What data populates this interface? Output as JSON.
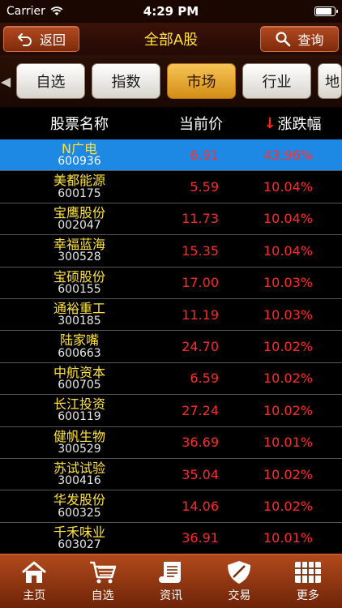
{
  "status_bar": {
    "carrier": "Carrier",
    "time": "4:29 PM",
    "battery_level": 0.9
  },
  "nav": {
    "back_label": "返回",
    "title": "全部A股",
    "search_label": "查询"
  },
  "tabs": [
    {
      "label": "自选",
      "active": false
    },
    {
      "label": "指数",
      "active": false
    },
    {
      "label": "市场",
      "active": true
    },
    {
      "label": "行业",
      "active": false
    },
    {
      "label": "地",
      "active": false
    }
  ],
  "table_header": {
    "name": "股票名称",
    "price": "当前价",
    "change": "涨跌幅"
  },
  "stocks": [
    {
      "name": "N广电",
      "code": "600936",
      "price": "6.91",
      "change": "43.96%"
    },
    {
      "name": "美都能源",
      "code": "600175",
      "price": "5.59",
      "change": "10.04%"
    },
    {
      "name": "宝鹰股份",
      "code": "002047",
      "price": "11.73",
      "change": "10.04%"
    },
    {
      "name": "幸福蓝海",
      "code": "300528",
      "price": "15.35",
      "change": "10.04%"
    },
    {
      "name": "宝硕股份",
      "code": "600155",
      "price": "17.00",
      "change": "10.03%"
    },
    {
      "name": "通裕重工",
      "code": "300185",
      "price": "11.19",
      "change": "10.03%"
    },
    {
      "name": "陆家嘴",
      "code": "600663",
      "price": "24.70",
      "change": "10.02%"
    },
    {
      "name": "中航资本",
      "code": "600705",
      "price": "6.59",
      "change": "10.02%"
    },
    {
      "name": "长江投资",
      "code": "600119",
      "price": "27.24",
      "change": "10.02%"
    },
    {
      "name": "健帆生物",
      "code": "300529",
      "price": "36.69",
      "change": "10.01%"
    },
    {
      "name": "苏试试验",
      "code": "300416",
      "price": "35.04",
      "change": "10.02%"
    },
    {
      "name": "华发股份",
      "code": "600325",
      "price": "14.06",
      "change": "10.02%"
    },
    {
      "name": "千禾味业",
      "code": "603027",
      "price": "36.91",
      "change": "10.01%"
    }
  ],
  "bottom_nav": [
    {
      "label": "主页",
      "icon": "home-icon"
    },
    {
      "label": "自选",
      "icon": "cart-icon"
    },
    {
      "label": "资讯",
      "icon": "scroll-icon"
    },
    {
      "label": "交易",
      "icon": "shield-icon"
    },
    {
      "label": "更多",
      "icon": "grid-icon"
    }
  ],
  "colors": {
    "accent_yellow": "#ffe23a",
    "price_red": "#ff2b2b",
    "selected_row": "#1e88e5",
    "active_tab": "#e8a32a"
  }
}
